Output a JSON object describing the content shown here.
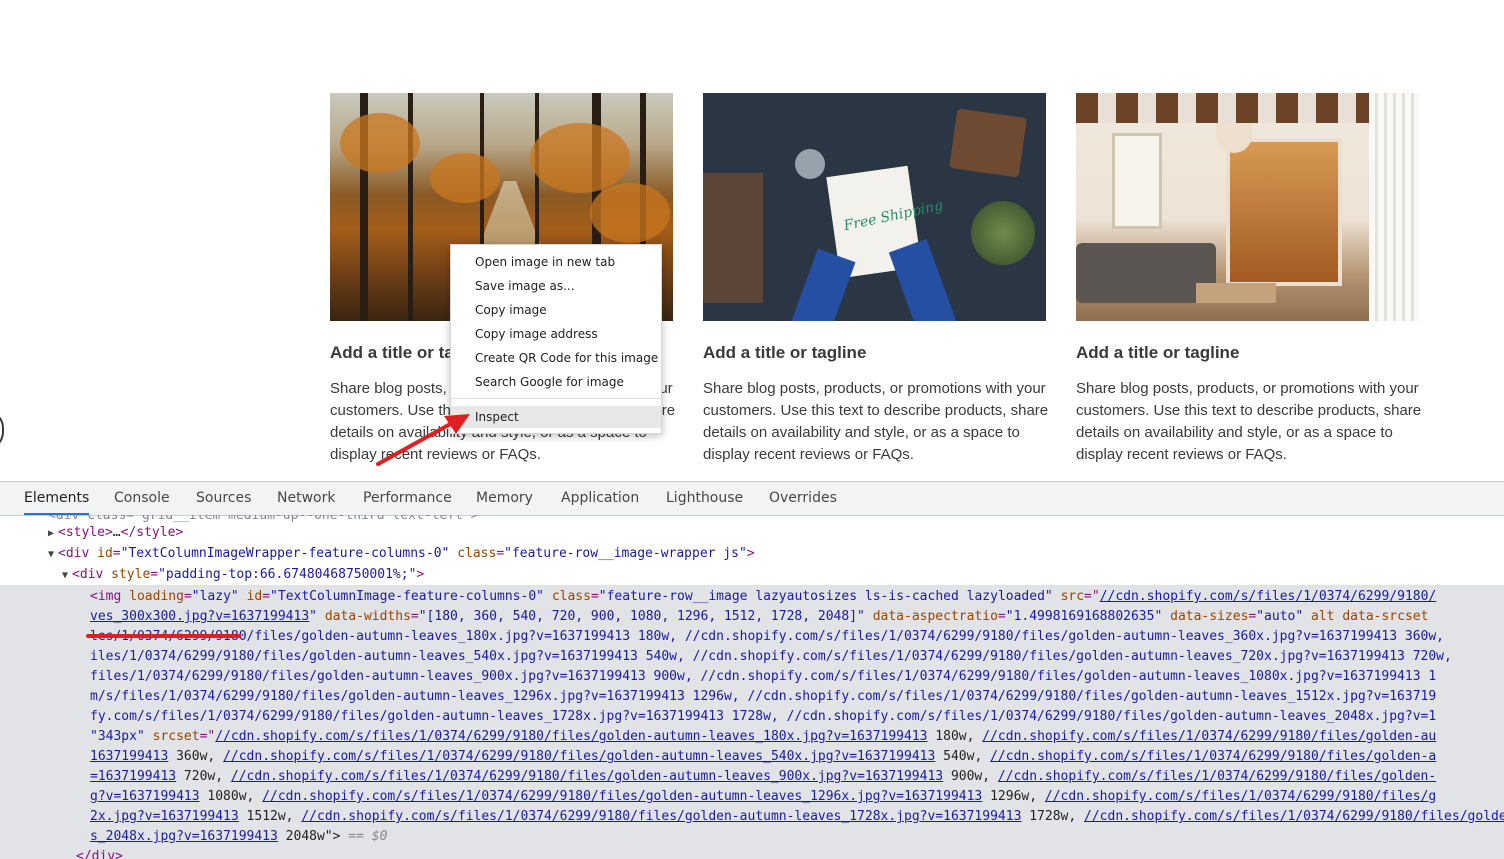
{
  "cards": [
    {
      "title": "Add a title or ta",
      "text": "Share blog posts, products, or promotions with your customers. Use this text to describe products, share details on availability and style, or as a space to display recent reviews or FAQs."
    },
    {
      "title": "Add a title or tagline",
      "text": "Share blog posts, products, or promotions with your customers. Use this text to describe products, share details on availability and style, or as a space to display recent reviews or FAQs."
    },
    {
      "title": "Add a title or tagline",
      "text": "Share blog posts, products, or promotions with your customers. Use this text to describe products, share details on availability and style, or as a space to display recent reviews or FAQs."
    }
  ],
  "card2_image_text": "Free Shipping",
  "context_menu": {
    "items": [
      "Open image in new tab",
      "Save image as...",
      "Copy image",
      "Copy image address",
      "Create QR Code for this image",
      "Search Google for image"
    ],
    "inspect": "Inspect"
  },
  "devtools": {
    "tabs": [
      "Elements",
      "Console",
      "Sources",
      "Network",
      "Performance",
      "Memory",
      "Application",
      "Lighthouse",
      "Overrides"
    ],
    "active_tab": "Elements",
    "lines": {
      "l0": "<div class=\"grid__item medium-up--one-third text-left\">",
      "l1a": "<style>",
      "l1b": "…",
      "l1c": "</style>",
      "l2_tag_open": "<div ",
      "l2_attr1": "id",
      "l2_val1": "\"TextColumnImageWrapper-feature-columns-0\"",
      "l2_attr2": "class",
      "l2_val2": "\"feature-row__image-wrapper js\"",
      "l2_close": ">",
      "l3_tag_open": "<div ",
      "l3_attr": "style",
      "l3_val": "\"padding-top:66.67480468750001%;\"",
      "l3_close": ">",
      "l4_tag": "<img ",
      "l4_a1": "loading",
      "l4_v1": "\"lazy\"",
      "l4_a2": "id",
      "l4_v2": "\"TextColumnImage-feature-columns-0\"",
      "l4_a3": "class",
      "l4_v3": "\"feature-row__image lazyautosizes ls-is-cached lazyloaded\"",
      "l4_a4": "src",
      "l4_link": "//cdn.shopify.com/s/files/1/0374/6299/9180/",
      "l5_link": "ves_300x300.jpg?v=1637199413",
      "l5_a1": "data-widths",
      "l5_v1": "\"[180, 360, 540, 720, 900, 1080, 1296, 1512, 1728, 2048]\"",
      "l5_a2": "data-aspectratio",
      "l5_v2": "\"1.4998169168802635\"",
      "l5_a3": "data-sizes",
      "l5_v3": "\"auto\"",
      "l5_a4": "alt",
      "l5_a5": "data-srcset",
      "l6": "les/1/0374/6299/9180/files/golden-autumn-leaves_180x.jpg?v=1637199413 180w, //cdn.shopify.com/s/files/1/0374/6299/9180/files/golden-autumn-leaves_360x.jpg?v=1637199413 360w,",
      "l7": "iles/1/0374/6299/9180/files/golden-autumn-leaves_540x.jpg?v=1637199413 540w, //cdn.shopify.com/s/files/1/0374/6299/9180/files/golden-autumn-leaves_720x.jpg?v=1637199413 720w,",
      "l8": "files/1/0374/6299/9180/files/golden-autumn-leaves_900x.jpg?v=1637199413 900w, //cdn.shopify.com/s/files/1/0374/6299/9180/files/golden-autumn-leaves_1080x.jpg?v=1637199413 1",
      "l9": "m/s/files/1/0374/6299/9180/files/golden-autumn-leaves_1296x.jpg?v=1637199413 1296w, //cdn.shopify.com/s/files/1/0374/6299/9180/files/golden-autumn-leaves_1512x.jpg?v=163719",
      "l10": "fy.com/s/files/1/0374/6299/9180/files/golden-autumn-leaves_1728x.jpg?v=1637199413 1728w, //cdn.shopify.com/s/files/1/0374/6299/9180/files/golden-autumn-leaves_2048x.jpg?v=1",
      "l11_v": "\"343px\"",
      "l11_a": "srcset",
      "l11_link": "//cdn.shopify.com/s/files/1/0374/6299/9180/files/golden-autumn-leaves_180x.jpg?v=1637199413",
      "l11_w": " 180w, ",
      "l11_link2": "//cdn.shopify.com/s/files/1/0374/6299/9180/files/golden-au",
      "l12_link": "1637199413",
      "l12_w": " 360w, ",
      "l12_link2": "//cdn.shopify.com/s/files/1/0374/6299/9180/files/golden-autumn-leaves_540x.jpg?v=1637199413",
      "l12_w2": " 540w, ",
      "l12_link3": "//cdn.shopify.com/s/files/1/0374/6299/9180/files/golden-a",
      "l13_link": "=1637199413",
      "l13_w": " 720w, ",
      "l13_link2": "//cdn.shopify.com/s/files/1/0374/6299/9180/files/golden-autumn-leaves_900x.jpg?v=1637199413",
      "l13_w2": " 900w, ",
      "l13_link3": "//cdn.shopify.com/s/files/1/0374/6299/9180/files/golden-",
      "l14_link": "g?v=1637199413",
      "l14_w": " 1080w, ",
      "l14_link2": "//cdn.shopify.com/s/files/1/0374/6299/9180/files/golden-autumn-leaves_1296x.jpg?v=1637199413",
      "l14_w2": " 1296w, ",
      "l14_link3": "//cdn.shopify.com/s/files/1/0374/6299/9180/files/g",
      "l15_link": "2x.jpg?v=1637199413",
      "l15_w": " 1512w, ",
      "l15_link2": "//cdn.shopify.com/s/files/1/0374/6299/9180/files/golden-autumn-leaves_1728x.jpg?v=1637199413",
      "l15_w2": " 1728w, ",
      "l15_link3": "//cdn.shopify.com/s/files/1/0374/6299/9180/files/golden-autumn-leave",
      "l16_link": "s_2048x.jpg?v=1637199413",
      "l16_w": " 2048w\">",
      "l16_eq": " == $0",
      "l17": "</div>"
    }
  },
  "colors": {
    "annotation": "#e02020",
    "devtools_tab_active": "#1a73e8"
  }
}
